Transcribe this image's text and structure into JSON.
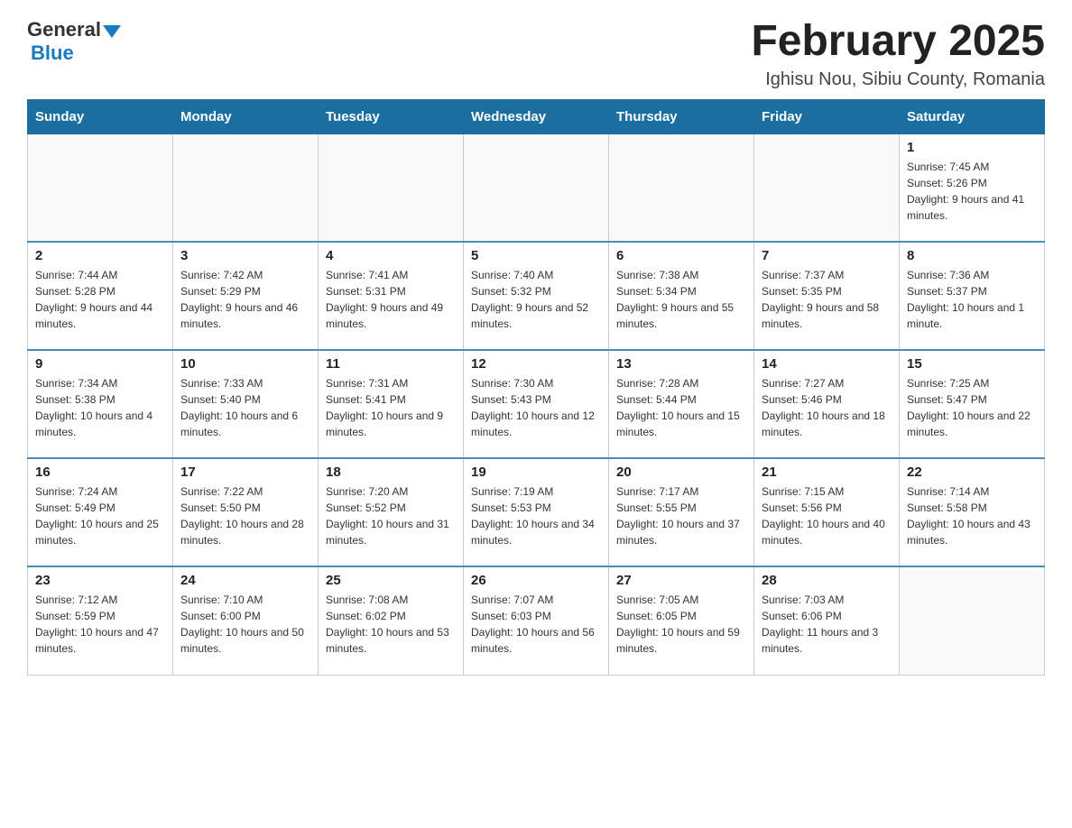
{
  "logo": {
    "general": "General",
    "blue": "Blue"
  },
  "title": "February 2025",
  "location": "Ighisu Nou, Sibiu County, Romania",
  "days_of_week": [
    "Sunday",
    "Monday",
    "Tuesday",
    "Wednesday",
    "Thursday",
    "Friday",
    "Saturday"
  ],
  "weeks": [
    [
      {
        "day": "",
        "info": ""
      },
      {
        "day": "",
        "info": ""
      },
      {
        "day": "",
        "info": ""
      },
      {
        "day": "",
        "info": ""
      },
      {
        "day": "",
        "info": ""
      },
      {
        "day": "",
        "info": ""
      },
      {
        "day": "1",
        "info": "Sunrise: 7:45 AM\nSunset: 5:26 PM\nDaylight: 9 hours and 41 minutes."
      }
    ],
    [
      {
        "day": "2",
        "info": "Sunrise: 7:44 AM\nSunset: 5:28 PM\nDaylight: 9 hours and 44 minutes."
      },
      {
        "day": "3",
        "info": "Sunrise: 7:42 AM\nSunset: 5:29 PM\nDaylight: 9 hours and 46 minutes."
      },
      {
        "day": "4",
        "info": "Sunrise: 7:41 AM\nSunset: 5:31 PM\nDaylight: 9 hours and 49 minutes."
      },
      {
        "day": "5",
        "info": "Sunrise: 7:40 AM\nSunset: 5:32 PM\nDaylight: 9 hours and 52 minutes."
      },
      {
        "day": "6",
        "info": "Sunrise: 7:38 AM\nSunset: 5:34 PM\nDaylight: 9 hours and 55 minutes."
      },
      {
        "day": "7",
        "info": "Sunrise: 7:37 AM\nSunset: 5:35 PM\nDaylight: 9 hours and 58 minutes."
      },
      {
        "day": "8",
        "info": "Sunrise: 7:36 AM\nSunset: 5:37 PM\nDaylight: 10 hours and 1 minute."
      }
    ],
    [
      {
        "day": "9",
        "info": "Sunrise: 7:34 AM\nSunset: 5:38 PM\nDaylight: 10 hours and 4 minutes."
      },
      {
        "day": "10",
        "info": "Sunrise: 7:33 AM\nSunset: 5:40 PM\nDaylight: 10 hours and 6 minutes."
      },
      {
        "day": "11",
        "info": "Sunrise: 7:31 AM\nSunset: 5:41 PM\nDaylight: 10 hours and 9 minutes."
      },
      {
        "day": "12",
        "info": "Sunrise: 7:30 AM\nSunset: 5:43 PM\nDaylight: 10 hours and 12 minutes."
      },
      {
        "day": "13",
        "info": "Sunrise: 7:28 AM\nSunset: 5:44 PM\nDaylight: 10 hours and 15 minutes."
      },
      {
        "day": "14",
        "info": "Sunrise: 7:27 AM\nSunset: 5:46 PM\nDaylight: 10 hours and 18 minutes."
      },
      {
        "day": "15",
        "info": "Sunrise: 7:25 AM\nSunset: 5:47 PM\nDaylight: 10 hours and 22 minutes."
      }
    ],
    [
      {
        "day": "16",
        "info": "Sunrise: 7:24 AM\nSunset: 5:49 PM\nDaylight: 10 hours and 25 minutes."
      },
      {
        "day": "17",
        "info": "Sunrise: 7:22 AM\nSunset: 5:50 PM\nDaylight: 10 hours and 28 minutes."
      },
      {
        "day": "18",
        "info": "Sunrise: 7:20 AM\nSunset: 5:52 PM\nDaylight: 10 hours and 31 minutes."
      },
      {
        "day": "19",
        "info": "Sunrise: 7:19 AM\nSunset: 5:53 PM\nDaylight: 10 hours and 34 minutes."
      },
      {
        "day": "20",
        "info": "Sunrise: 7:17 AM\nSunset: 5:55 PM\nDaylight: 10 hours and 37 minutes."
      },
      {
        "day": "21",
        "info": "Sunrise: 7:15 AM\nSunset: 5:56 PM\nDaylight: 10 hours and 40 minutes."
      },
      {
        "day": "22",
        "info": "Sunrise: 7:14 AM\nSunset: 5:58 PM\nDaylight: 10 hours and 43 minutes."
      }
    ],
    [
      {
        "day": "23",
        "info": "Sunrise: 7:12 AM\nSunset: 5:59 PM\nDaylight: 10 hours and 47 minutes."
      },
      {
        "day": "24",
        "info": "Sunrise: 7:10 AM\nSunset: 6:00 PM\nDaylight: 10 hours and 50 minutes."
      },
      {
        "day": "25",
        "info": "Sunrise: 7:08 AM\nSunset: 6:02 PM\nDaylight: 10 hours and 53 minutes."
      },
      {
        "day": "26",
        "info": "Sunrise: 7:07 AM\nSunset: 6:03 PM\nDaylight: 10 hours and 56 minutes."
      },
      {
        "day": "27",
        "info": "Sunrise: 7:05 AM\nSunset: 6:05 PM\nDaylight: 10 hours and 59 minutes."
      },
      {
        "day": "28",
        "info": "Sunrise: 7:03 AM\nSunset: 6:06 PM\nDaylight: 11 hours and 3 minutes."
      },
      {
        "day": "",
        "info": ""
      }
    ]
  ]
}
